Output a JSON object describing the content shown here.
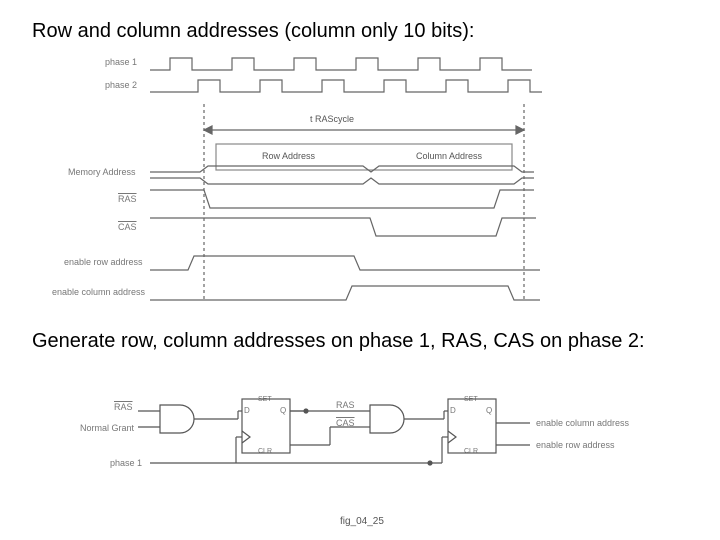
{
  "headings": {
    "top": "Row and column addresses (column only 10 bits):",
    "mid": "Generate row, column addresses on phase 1, RAS, CAS on phase 2:"
  },
  "timing": {
    "phase1": "phase 1",
    "phase2": "phase 2",
    "t_label": "t RAScycle",
    "memory_address": "Memory Address",
    "row_address": "Row Address",
    "column_address": "Column Address",
    "ras": "RAS",
    "cas": "CAS",
    "enable_row": "enable row address",
    "enable_col": "enable column address"
  },
  "circuit": {
    "ras": "RAS",
    "normal_grant": "Normal Grant",
    "phase1": "phase 1",
    "d": "D",
    "q": "Q",
    "set": "SET",
    "clr": "CLR",
    "cas": "CAS",
    "enable_col": "enable column address",
    "enable_row": "enable row address"
  },
  "footer": "fig_04_25"
}
